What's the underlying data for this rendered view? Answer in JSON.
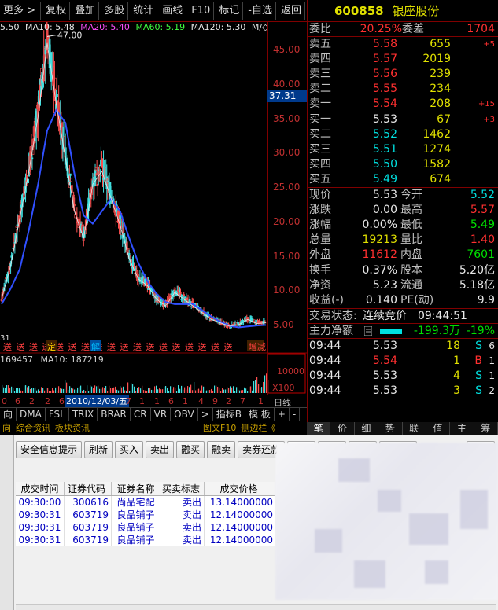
{
  "toolbar": [
    "更多 >",
    "复权",
    "叠加",
    "多股",
    "统计",
    "画线",
    "F10",
    "标记",
    "-自选",
    "返回"
  ],
  "ma_line": {
    "price": "5.50",
    "ma10": "MA10: 5.48",
    "ma20": "MA20: 5.40",
    "ma60": "MA60: 5.19",
    "ma120": "MA120: 5.30",
    "suffix": "M/◇"
  },
  "chart": {
    "peak_label": "47.00",
    "current_price_label": "37.31",
    "y_ticks": [
      "45.00",
      "40.00",
      "35.00",
      "30.00",
      "25.00",
      "20.00",
      "15.00",
      "10.00",
      "5.00"
    ],
    "left_label": "31",
    "markers": [
      "送",
      "送",
      "送",
      "送",
      "送",
      "送",
      "送",
      "送",
      "送",
      "送",
      "送",
      "送",
      "送",
      "送",
      "送",
      "送",
      "送",
      "送"
    ],
    "event_labels": [
      "定",
      "解",
      "增减"
    ]
  },
  "chart_data": {
    "type": "line",
    "series": [
      {
        "name": "price",
        "values": [
          9,
          14,
          21,
          28,
          36,
          47,
          38,
          30,
          22,
          18,
          26,
          28,
          24,
          20,
          15,
          12,
          11,
          9,
          8,
          10,
          9,
          8,
          7,
          6,
          5.5,
          5,
          5.2,
          6,
          5.4,
          5.5
        ]
      }
    ],
    "ylim": [
      4,
      48
    ]
  },
  "volume": {
    "label": "169457",
    "ma10": "MA10: 187219",
    "ticks": [
      "10000",
      "X100"
    ]
  },
  "dates": {
    "current": "2010/12/03/五",
    "nums": [
      "0",
      "6",
      "2",
      "2",
      "6",
      "7",
      "1",
      "1",
      "6",
      "1",
      "4",
      "9",
      "2",
      "7",
      "1"
    ],
    "right": "日线"
  },
  "indicator_tabs": [
    "向",
    "DMA",
    "FSL",
    "TRIX",
    "BRAR",
    "CR",
    "VR",
    "OBV",
    ">",
    "指标B",
    "模 板",
    "+",
    "-"
  ],
  "news_tabs": [
    "向",
    "综合资讯",
    "板块资讯",
    "图文F10",
    "侧边栏《"
  ],
  "quote": {
    "code": "600858",
    "name": "银座股份",
    "weibi_label": "委比",
    "weibi": "20.25%",
    "weicha_label": "委差",
    "weicha": "1704",
    "asks": [
      {
        "label": "卖五",
        "price": "5.58",
        "vol": "655",
        "chg": "+5"
      },
      {
        "label": "卖四",
        "price": "5.57",
        "vol": "2019",
        "chg": ""
      },
      {
        "label": "卖三",
        "price": "5.56",
        "vol": "239",
        "chg": ""
      },
      {
        "label": "卖二",
        "price": "5.55",
        "vol": "234",
        "chg": ""
      },
      {
        "label": "卖一",
        "price": "5.54",
        "vol": "208",
        "chg": "+15"
      }
    ],
    "bids": [
      {
        "label": "买一",
        "price": "5.53",
        "vol": "67",
        "chg": "+3"
      },
      {
        "label": "买二",
        "price": "5.52",
        "vol": "1462",
        "chg": ""
      },
      {
        "label": "买三",
        "price": "5.51",
        "vol": "1274",
        "chg": ""
      },
      {
        "label": "买四",
        "price": "5.50",
        "vol": "1582",
        "chg": ""
      },
      {
        "label": "买五",
        "price": "5.49",
        "vol": "674",
        "chg": ""
      }
    ],
    "stats": [
      {
        "l1": "现价",
        "v1": "5.53",
        "l2": "今开",
        "v2": "5.52",
        "c1": "white",
        "c2": "cyan"
      },
      {
        "l1": "涨跌",
        "v1": "0.00",
        "l2": "最高",
        "v2": "5.57",
        "c1": "white",
        "c2": "red"
      },
      {
        "l1": "涨幅",
        "v1": "0.00%",
        "l2": "最低",
        "v2": "5.49",
        "c1": "white",
        "c2": "green"
      },
      {
        "l1": "总量",
        "v1": "19213",
        "l2": "量比",
        "v2": "1.40",
        "c1": "yellow",
        "c2": "red"
      },
      {
        "l1": "外盘",
        "v1": "11612",
        "l2": "内盘",
        "v2": "7601",
        "c1": "red",
        "c2": "green"
      }
    ],
    "stats2": [
      {
        "l1": "换手",
        "v1": "0.37%",
        "l2": "股本",
        "v2": "5.20亿"
      },
      {
        "l1": "净资",
        "v1": "5.23",
        "l2": "流通",
        "v2": "5.18亿"
      },
      {
        "l1": "收益(-)",
        "v1": "0.140",
        "l2": "PE(动)",
        "v2": "9.9"
      }
    ],
    "trade_status_label": "交易状态:",
    "trade_status": "连续竞价",
    "trade_time": "09:44:51",
    "net_label": "主力净额",
    "net_value": "-199.3万",
    "net_pct": "-19%",
    "ticks": [
      {
        "time": "09:44",
        "price": "5.53",
        "vol": "18",
        "side": "S",
        "n": "6"
      },
      {
        "time": "09:44",
        "price": "5.54",
        "vol": "1",
        "side": "B",
        "n": "1"
      },
      {
        "time": "09:44",
        "price": "5.53",
        "vol": "4",
        "side": "S",
        "n": "1"
      },
      {
        "time": "09:44",
        "price": "5.53",
        "vol": "3",
        "side": "S",
        "n": "2"
      }
    ]
  },
  "panel_tabs": [
    "笔",
    "价",
    "细",
    "势",
    "联",
    "值",
    "主",
    "筹"
  ],
  "trade": {
    "buttons": [
      "安全信息提示",
      "刷新",
      "买入",
      "卖出",
      "融买",
      "融卖",
      "卖券还款",
      "成交",
      "持仓",
      "撤单",
      "日成交"
    ],
    "more_label": "多帐",
    "columns": [
      "成交时间",
      "证券代码",
      "证券名称",
      "买卖标志",
      "成交价格"
    ],
    "rows": [
      [
        "09:30:00",
        "300616",
        "尚品宅配",
        "卖出",
        "13.14000000"
      ],
      [
        "09:30:31",
        "603719",
        "良品铺子",
        "卖出",
        "12.14000000"
      ],
      [
        "09:30:31",
        "603719",
        "良品铺子",
        "卖出",
        "12.14000000"
      ],
      [
        "09:30:31",
        "603719",
        "良品铺子",
        "卖出",
        "12.14000000"
      ]
    ]
  }
}
